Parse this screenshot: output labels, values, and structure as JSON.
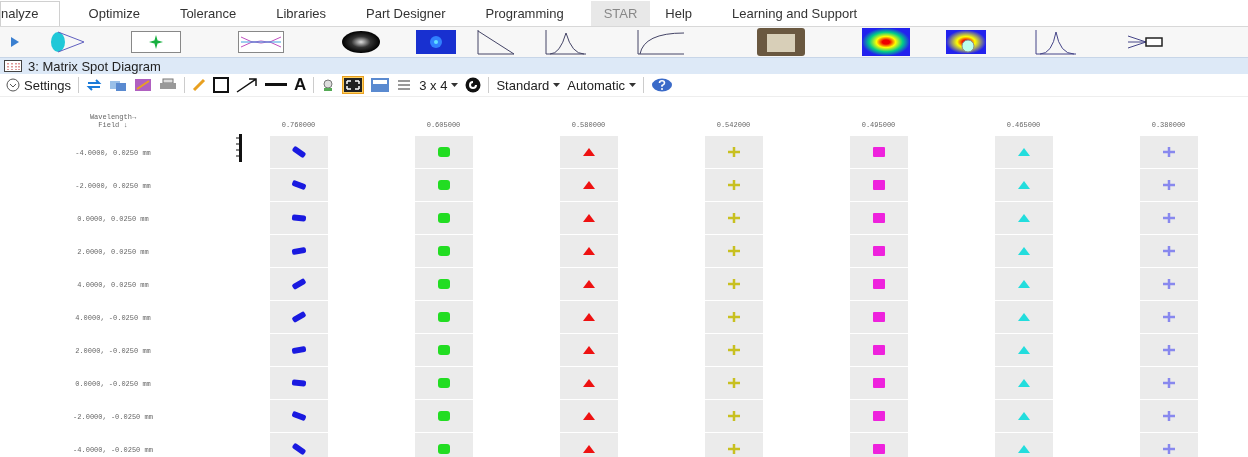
{
  "tabs": [
    {
      "label": "nalyze",
      "selected": true,
      "highlighted": false
    },
    {
      "label": "Optimize",
      "selected": false,
      "highlighted": false
    },
    {
      "label": "Tolerance",
      "selected": false,
      "highlighted": false
    },
    {
      "label": "Libraries",
      "selected": false,
      "highlighted": false
    },
    {
      "label": "Part Designer",
      "selected": false,
      "highlighted": false
    },
    {
      "label": "Programming",
      "selected": false,
      "highlighted": false
    },
    {
      "label": "STAR",
      "selected": false,
      "highlighted": true
    },
    {
      "label": "Help",
      "selected": false,
      "highlighted": false
    },
    {
      "label": "Learning and Support",
      "selected": false,
      "highlighted": false
    }
  ],
  "window": {
    "title": "3: Matrix Spot Diagram"
  },
  "toolbar": {
    "settings": "Settings",
    "text_tool": "A",
    "fit_toggle_selected": true,
    "layout": "3 x 4",
    "scale": "Standard",
    "mode": "Automatic"
  },
  "matrix": {
    "wavelength_label": "Wavelength→",
    "field_label": "Field ↓",
    "wavelengths": [
      {
        "label": "0.760000",
        "color": "#1a1ae0",
        "kind": "blob"
      },
      {
        "label": "0.605000",
        "color": "#22dd22",
        "kind": "rounded"
      },
      {
        "label": "0.580000",
        "color": "#ee1111",
        "kind": "triangle"
      },
      {
        "label": "0.542000",
        "color": "#c8c020",
        "kind": "cross"
      },
      {
        "label": "0.495000",
        "color": "#ee22dd",
        "kind": "square"
      },
      {
        "label": "0.465000",
        "color": "#22dddd",
        "kind": "triangle"
      },
      {
        "label": "0.380000",
        "color": "#8888ee",
        "kind": "cross"
      }
    ],
    "fields": [
      "-4.0000, 0.0250 mm",
      "-2.0000, 0.0250 mm",
      "0.0000, 0.0250 mm",
      "2.0000, 0.0250 mm",
      "4.0000, 0.0250 mm",
      "4.0000, -0.0250 mm",
      "2.0000, -0.0250 mm",
      "0.0000, -0.0250 mm",
      "-2.0000, -0.0250 mm",
      "-4.0000, -0.0250 mm"
    ]
  }
}
